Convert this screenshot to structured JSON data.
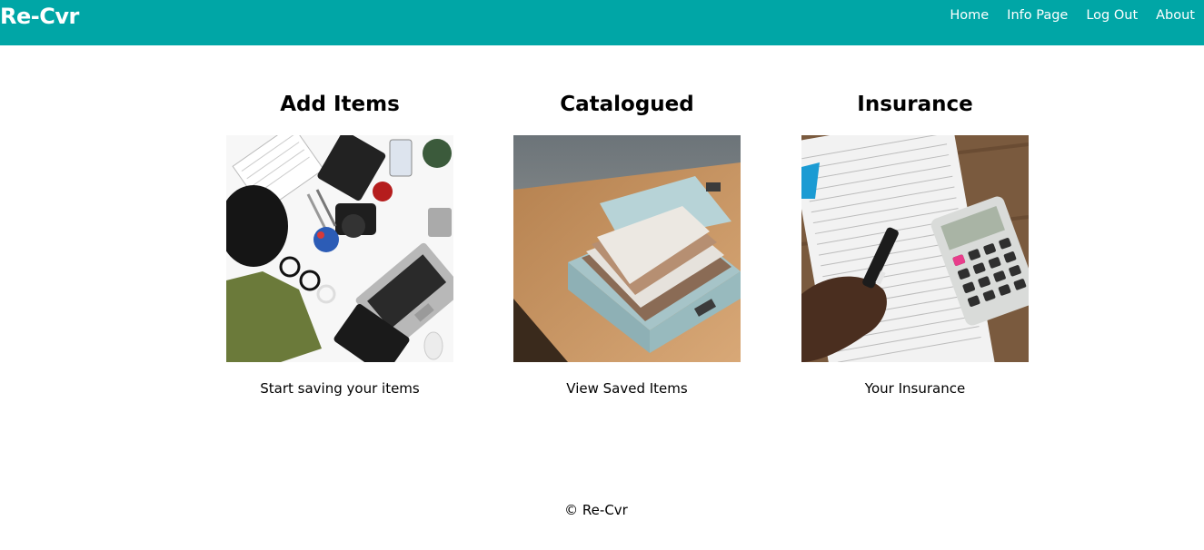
{
  "navbar": {
    "brand": "Re-Cvr",
    "links": [
      "Home",
      "Info Page",
      "Log Out",
      "About"
    ],
    "background_color": "#00a6a6"
  },
  "cards": [
    {
      "title": "Add Items",
      "caption": "Start saving your items",
      "image_icon": "flat-lay-items-photo"
    },
    {
      "title": "Catalogued",
      "caption": "View Saved Items",
      "image_icon": "file-box-photo"
    },
    {
      "title": "Insurance",
      "caption": "Your Insurance",
      "image_icon": "calculator-paperwork-photo"
    }
  ],
  "footer": {
    "text": "© Re-Cvr"
  }
}
